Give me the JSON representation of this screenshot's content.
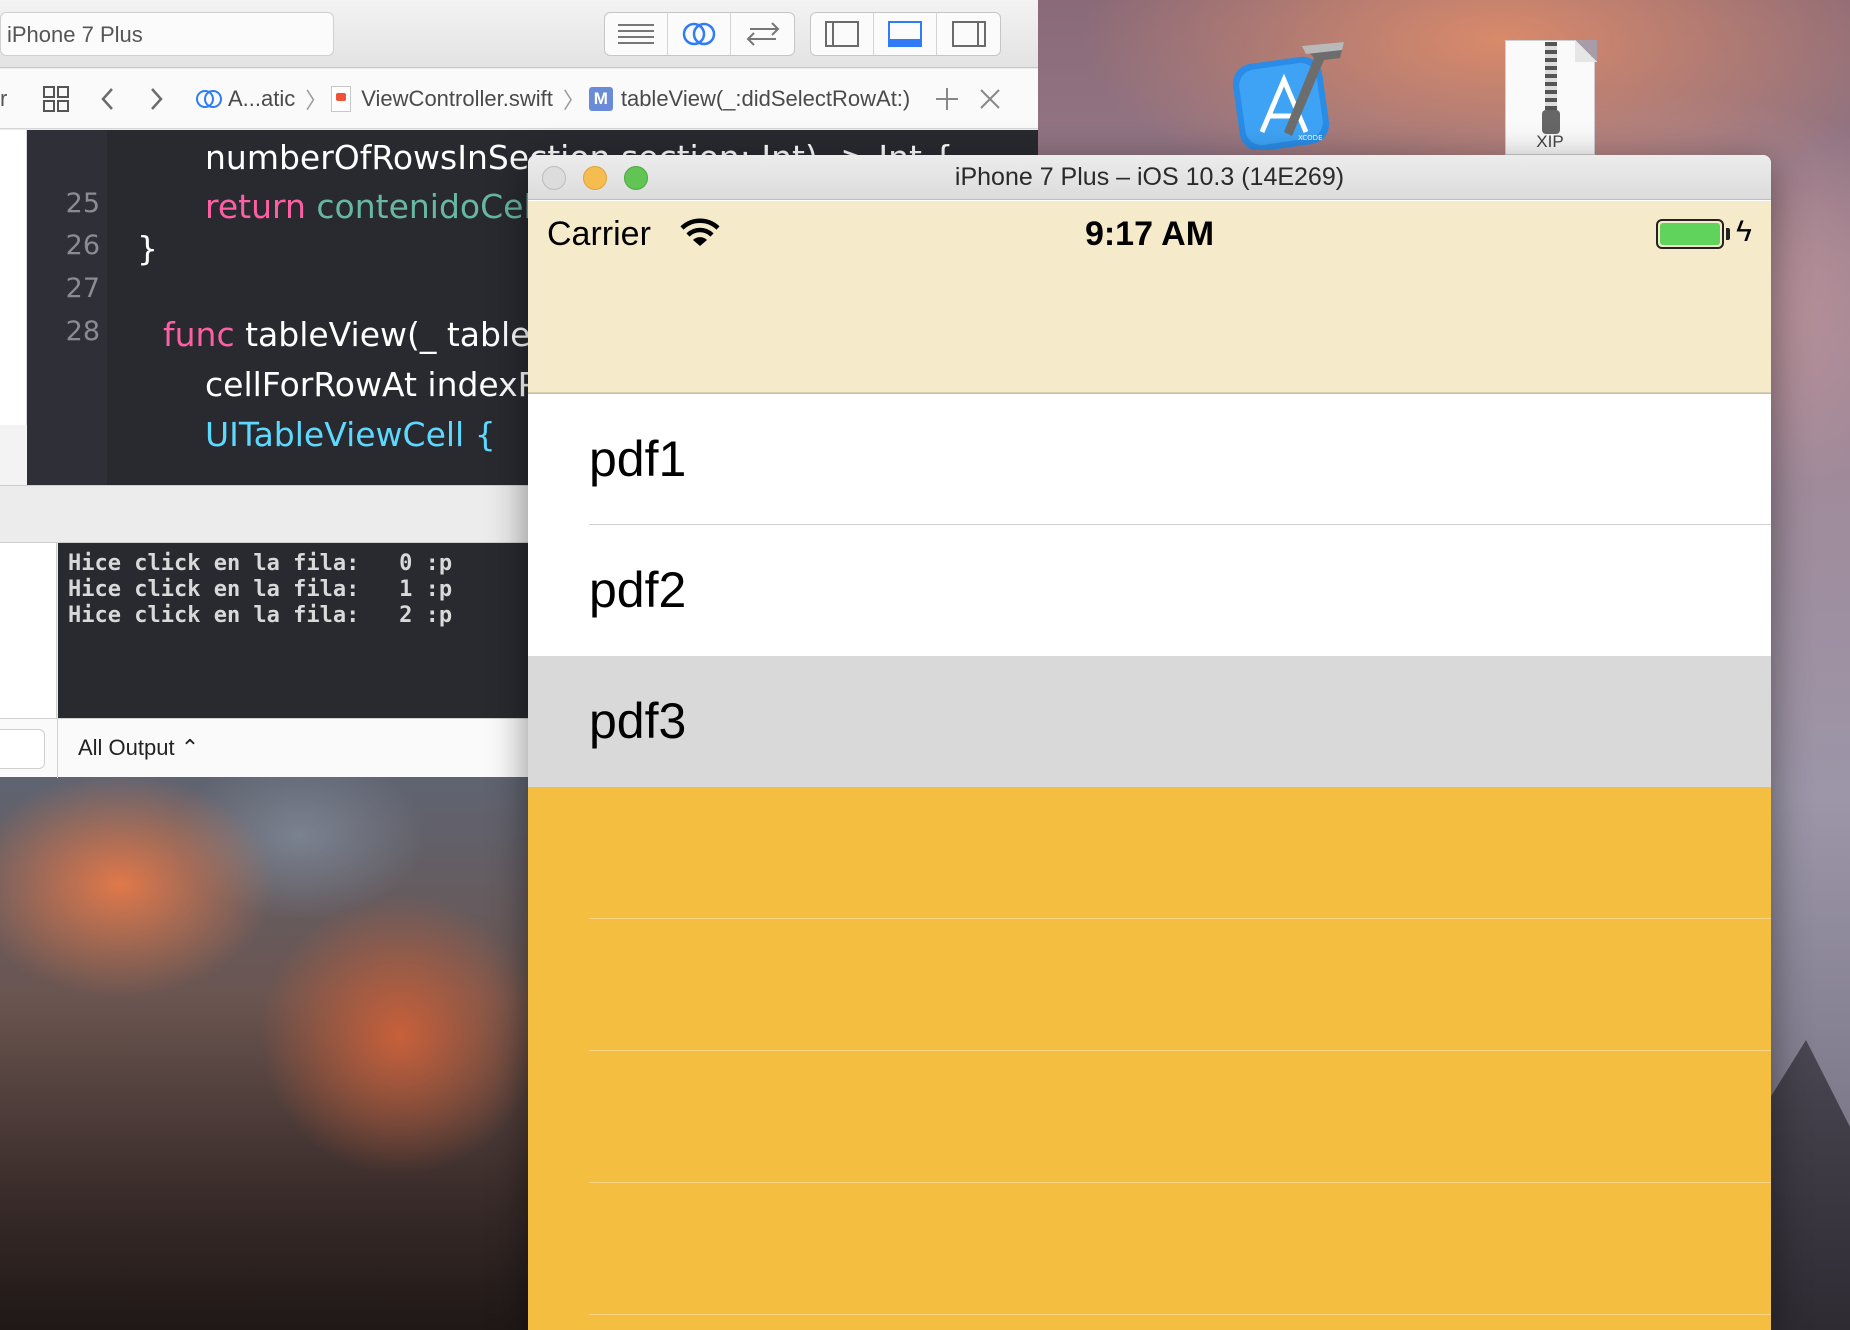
{
  "xcode": {
    "scheme": "iPhone 7 Plus",
    "jumpbar": {
      "folder": "A...atic",
      "file": "ViewController.swift",
      "method_badge": "M",
      "method": "tableView(_:didSelectRowAt:)"
    },
    "code": {
      "line_numbers": [
        "25",
        "26",
        "27",
        "28"
      ],
      "line0": "numberOfRowsInSection section: Int) -> Int {",
      "line25_kw": "return",
      "line25_rest": "contenidoCeldas.count",
      "line26": "}",
      "line28_kw": "func",
      "line28_rest": "tableView(_ tableView: UITableView,",
      "line29": "cellForRowAt indexPath: IndexPath) ->",
      "line30": "UITableViewCell {"
    },
    "console_lines": [
      "Hice click en la fila:   0 :p",
      "Hice click en la fila:   1 :p",
      "Hice click en la fila:   2 :p"
    ],
    "output_filter": "All Output ⌃"
  },
  "desktop": {
    "xip_label": "XIP",
    "xcode_icon_text": "XCODE"
  },
  "simulator": {
    "title": "iPhone 7 Plus – iOS 10.3 (14E269)",
    "status": {
      "carrier": "Carrier",
      "time": "9:17 AM"
    },
    "rows": [
      "pdf1",
      "pdf2",
      "pdf3"
    ],
    "selected_row": 2,
    "colors": {
      "nav": "#f5eac9",
      "background": "#f4bf41",
      "selected": "#d9d9d9",
      "battery": "#5fd35b"
    }
  }
}
